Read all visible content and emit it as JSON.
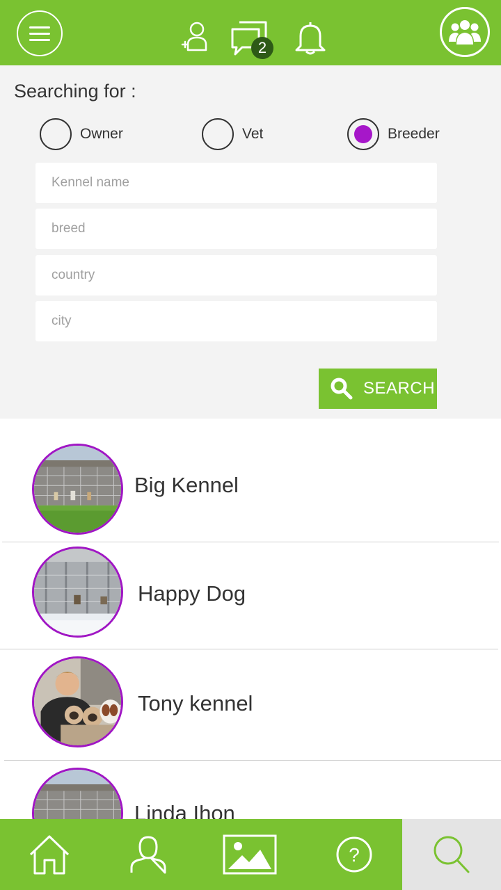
{
  "header": {
    "messages_badge": "2",
    "icons": [
      "menu-icon",
      "add-user-icon",
      "messages-icon",
      "bell-icon",
      "groups-icon"
    ]
  },
  "search": {
    "heading": "Searching for :",
    "options": [
      {
        "label": "Owner",
        "selected": false
      },
      {
        "label": "Vet",
        "selected": false
      },
      {
        "label": "Breeder",
        "selected": true
      }
    ],
    "fields": [
      {
        "placeholder": "Kennel name",
        "value": ""
      },
      {
        "placeholder": "breed",
        "value": ""
      },
      {
        "placeholder": "country",
        "value": ""
      },
      {
        "placeholder": "city",
        "value": ""
      }
    ],
    "button_label": "SEARCH"
  },
  "results": [
    {
      "name": "Big Kennel"
    },
    {
      "name": "Happy Dog"
    },
    {
      "name": "Tony kennel"
    },
    {
      "name": "Linda Ihon"
    }
  ],
  "bottom_nav": {
    "items": [
      "home-icon",
      "profile-icon",
      "gallery-icon",
      "help-icon",
      "search-icon"
    ],
    "active": "search-icon"
  },
  "colors": {
    "brand_green": "#7ac231",
    "accent_purple": "#a617c9",
    "badge_green": "#2e5a17",
    "active_nav_bg": "#e4e4e4"
  }
}
